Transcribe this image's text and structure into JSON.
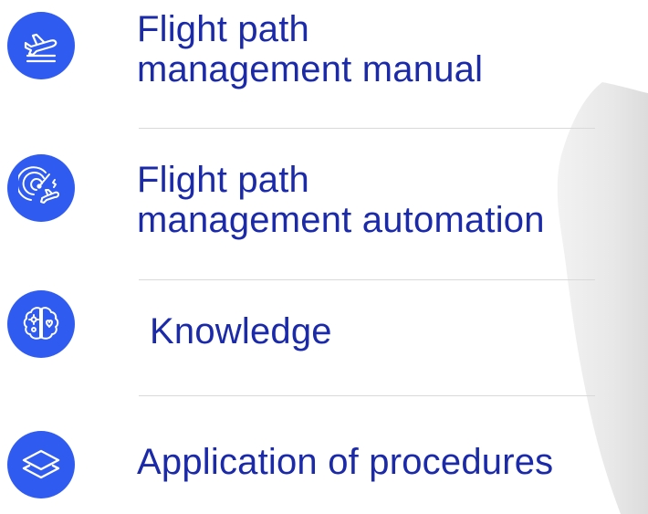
{
  "colors": {
    "accent": "#2f5bf0",
    "text": "#1b2aa8",
    "divider": "#d9d9d9",
    "background": "#ffffff"
  },
  "items": [
    {
      "line1": "Flight path",
      "line2": "management manual",
      "icon": "airplane-takeoff-icon"
    },
    {
      "line1": "Flight path",
      "line2": "management automation",
      "icon": "radar-airplane-icon"
    },
    {
      "line1": "Knowledge",
      "line2": "",
      "icon": "brain-gear-heart-icon"
    },
    {
      "line1": "Application of procedures",
      "line2": "",
      "icon": "stacked-layers-icon"
    }
  ]
}
